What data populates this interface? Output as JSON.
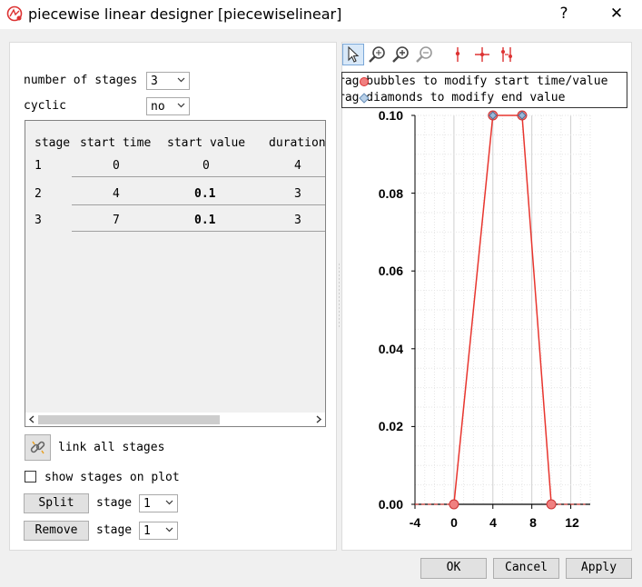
{
  "window": {
    "title": "piecewise linear designer [piecewiselinear]",
    "help_glyph": "?",
    "close_glyph": "✕",
    "app_icon": "piecewise-app-icon"
  },
  "settings": {
    "stages_label": "number of stages",
    "stages_value": "3",
    "cyclic_label": "cyclic",
    "cyclic_value": "no"
  },
  "table": {
    "headers": [
      "stage",
      "start time",
      "start value",
      "duration"
    ],
    "rows": [
      {
        "stage": "1",
        "start_time": "0",
        "start_value": "0",
        "duration": "4"
      },
      {
        "stage": "2",
        "start_time": "4",
        "start_value": "0.1",
        "duration": "3"
      },
      {
        "stage": "3",
        "start_time": "7",
        "start_value": "0.1",
        "duration": "3"
      }
    ]
  },
  "controls": {
    "link_label": "link all stages",
    "show_stages_label": "show stages on plot",
    "show_stages_checked": false,
    "split_label": "Split",
    "remove_label": "Remove",
    "stage_label": "stage",
    "split_stage_value": "1",
    "remove_stage_value": "1"
  },
  "legend": {
    "line1": "rag  bubbles to modify start time/value",
    "line2": "rag  diamonds to modify end value"
  },
  "footer": {
    "ok_label": "OK",
    "cancel_label": "Cancel",
    "apply_label": "Apply"
  },
  "colors": {
    "line": "#e8352e",
    "bubble": "#f08080",
    "diamond": "#9ab8d8"
  },
  "chart_data": {
    "type": "line",
    "series": [
      {
        "x": [
          0,
          4,
          7,
          10
        ],
        "y": [
          0,
          0.1,
          0.1,
          0
        ]
      }
    ],
    "xlim": [
      -4,
      14
    ],
    "ylim": [
      0,
      0.1
    ],
    "xticks": [
      "-4",
      "0",
      "4",
      "8",
      "12"
    ],
    "yticks": [
      "0.00",
      "0.02",
      "0.04",
      "0.06",
      "0.08",
      "0.10"
    ],
    "grid": true
  }
}
